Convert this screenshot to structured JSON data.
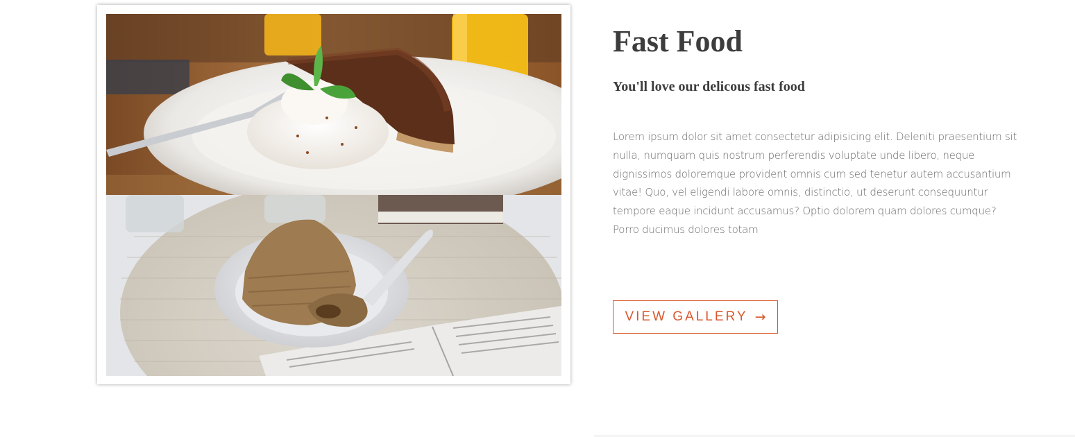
{
  "section": {
    "title": "Fast Food",
    "subtitle": "You'll love our delicous fast food",
    "description": "Lorem ipsum dolor sit amet consectetur adipisicing elit. Deleniti praesentium sit nulla, numquam quis nostrum perferendis voluptate unde libero, neque dignissimos doloremque provident omnis cum sed tenetur autem accusantium vitae! Quo, vel eligendi labore omnis, distinctio, ut deserunt consequuntur tempore eaque incidunt accusamus? Optio dolorem quam dolores cumque? Porro ducimus dolores totam",
    "button_label": "VIEW GALLERY",
    "button_icon": "arrow-right-icon",
    "button_arrow": "→"
  },
  "gallery": {
    "images": [
      {
        "subject": "chocolate cake with whipped cream and mint on white plate"
      },
      {
        "subject": "piece of sponge cake on small plate with book"
      }
    ]
  },
  "colors": {
    "accent": "#d9562b",
    "heading": "#3d3d3d",
    "body": "#6a6a6a"
  }
}
